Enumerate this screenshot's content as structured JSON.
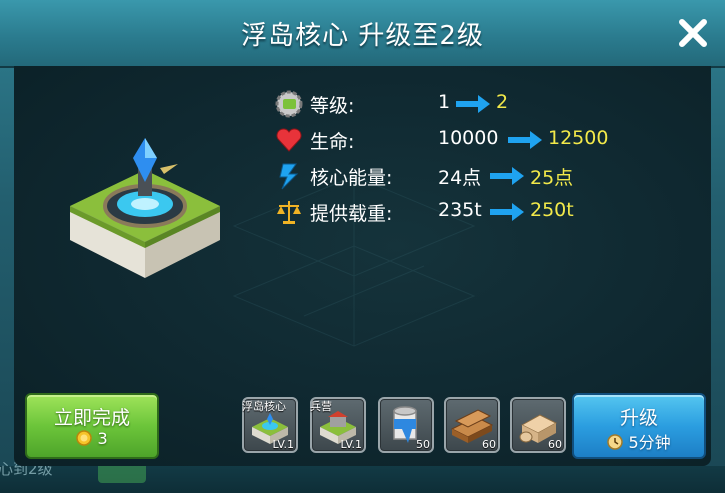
{
  "dialog": {
    "title": "浮岛核心 升级至2级",
    "close_icon": "close-icon"
  },
  "stats": [
    {
      "icon": "level-gear-icon",
      "label": "等级:",
      "current": "1",
      "next": "2"
    },
    {
      "icon": "heart-icon",
      "label": "生命:",
      "current": "10000",
      "next": "12500"
    },
    {
      "icon": "lightning-icon",
      "label": "核心能量:",
      "current": "24点",
      "next": "25点"
    },
    {
      "icon": "scale-icon",
      "label": "提供载重:",
      "current": "235t",
      "next": "250t"
    }
  ],
  "instant_button": {
    "label": "立即完成",
    "cost": "3",
    "icon": "gold-coin-icon"
  },
  "upgrade_button": {
    "label": "升级",
    "time": "5分钟",
    "icon": "clock-icon"
  },
  "requirements": [
    {
      "name": "浮岛核心",
      "level": "LV.1",
      "icon": "island-core-icon"
    },
    {
      "name": "兵营",
      "level": "LV.1",
      "icon": "barracks-icon"
    }
  ],
  "resources": [
    {
      "icon": "paint-bucket-icon",
      "amount": "50"
    },
    {
      "icon": "wood-plank-icon",
      "amount": "60"
    },
    {
      "icon": "stone-block-icon",
      "amount": "60"
    }
  ],
  "background_text": "心到2级",
  "colors": {
    "next_value": "#f2e94a",
    "arrow": "#1fa3f0",
    "instant_button": "#6cc53a",
    "upgrade_button": "#2b9ee0"
  }
}
